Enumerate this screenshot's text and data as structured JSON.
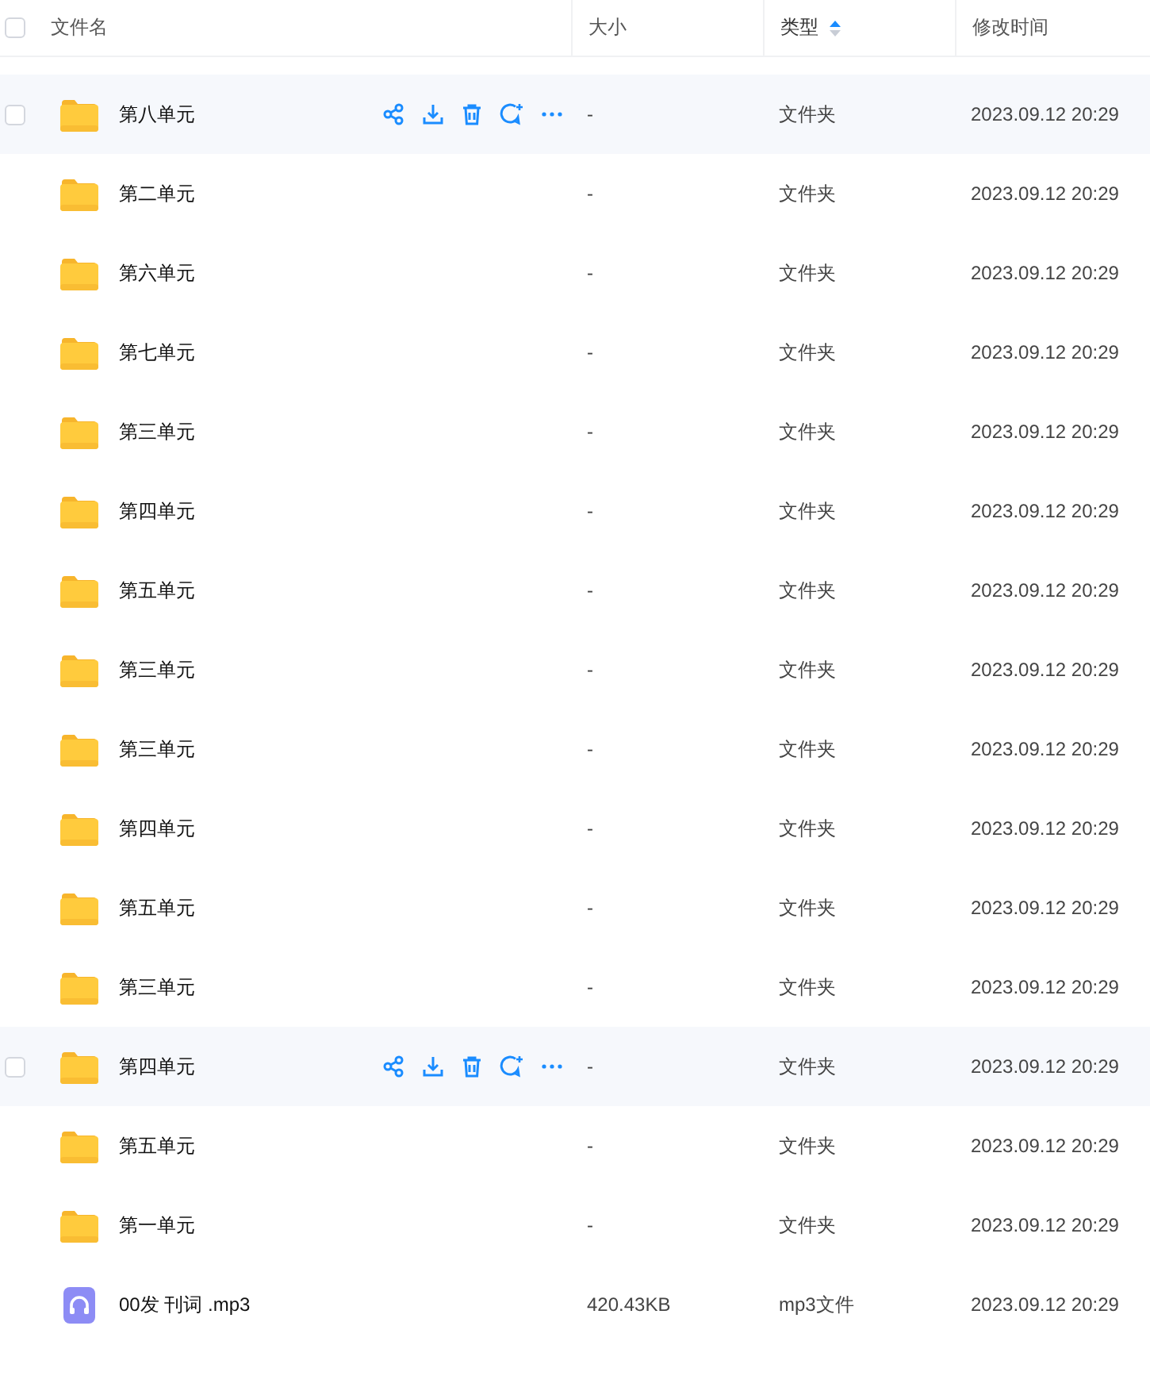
{
  "select_all": {
    "checked": false
  },
  "columns": [
    {
      "label": "文件名",
      "sorted": false
    },
    {
      "label": "大小",
      "sorted": false
    },
    {
      "label": "类型",
      "sorted": true
    },
    {
      "label": "修改时间",
      "sorted": false
    }
  ],
  "rows": [
    {
      "kind": "folder",
      "name": "第八单元",
      "size": "-",
      "type": "文件夹",
      "modified": "2023.09.12 20:29",
      "hovered": true,
      "checked": false
    },
    {
      "kind": "folder",
      "name": "第二单元",
      "size": "-",
      "type": "文件夹",
      "modified": "2023.09.12 20:29",
      "hovered": false,
      "checked": false
    },
    {
      "kind": "folder",
      "name": "第六单元",
      "size": "-",
      "type": "文件夹",
      "modified": "2023.09.12 20:29",
      "hovered": false,
      "checked": false
    },
    {
      "kind": "folder",
      "name": "第七单元",
      "size": "-",
      "type": "文件夹",
      "modified": "2023.09.12 20:29",
      "hovered": false,
      "checked": false
    },
    {
      "kind": "folder",
      "name": "第三单元",
      "size": "-",
      "type": "文件夹",
      "modified": "2023.09.12 20:29",
      "hovered": false,
      "checked": false
    },
    {
      "kind": "folder",
      "name": "第四单元",
      "size": "-",
      "type": "文件夹",
      "modified": "2023.09.12 20:29",
      "hovered": false,
      "checked": false
    },
    {
      "kind": "folder",
      "name": "第五单元",
      "size": "-",
      "type": "文件夹",
      "modified": "2023.09.12 20:29",
      "hovered": false,
      "checked": false
    },
    {
      "kind": "folder",
      "name": "第三单元",
      "size": "-",
      "type": "文件夹",
      "modified": "2023.09.12 20:29",
      "hovered": false,
      "checked": false
    },
    {
      "kind": "folder",
      "name": "第三单元",
      "size": "-",
      "type": "文件夹",
      "modified": "2023.09.12 20:29",
      "hovered": false,
      "checked": false
    },
    {
      "kind": "folder",
      "name": "第四单元",
      "size": "-",
      "type": "文件夹",
      "modified": "2023.09.12 20:29",
      "hovered": false,
      "checked": false
    },
    {
      "kind": "folder",
      "name": "第五单元",
      "size": "-",
      "type": "文件夹",
      "modified": "2023.09.12 20:29",
      "hovered": false,
      "checked": false
    },
    {
      "kind": "folder",
      "name": "第三单元",
      "size": "-",
      "type": "文件夹",
      "modified": "2023.09.12 20:29",
      "hovered": false,
      "checked": false
    },
    {
      "kind": "folder",
      "name": "第四单元",
      "size": "-",
      "type": "文件夹",
      "modified": "2023.09.12 20:29",
      "hovered": true,
      "checked": false
    },
    {
      "kind": "folder",
      "name": "第五单元",
      "size": "-",
      "type": "文件夹",
      "modified": "2023.09.12 20:29",
      "hovered": false,
      "checked": false
    },
    {
      "kind": "folder",
      "name": "第一单元",
      "size": "-",
      "type": "文件夹",
      "modified": "2023.09.12 20:29",
      "hovered": false,
      "checked": false
    },
    {
      "kind": "audio",
      "name": "00发 刊词 .mp3",
      "size": "420.43KB",
      "type": "mp3文件",
      "modified": "2023.09.12 20:29",
      "hovered": false,
      "checked": false
    }
  ]
}
